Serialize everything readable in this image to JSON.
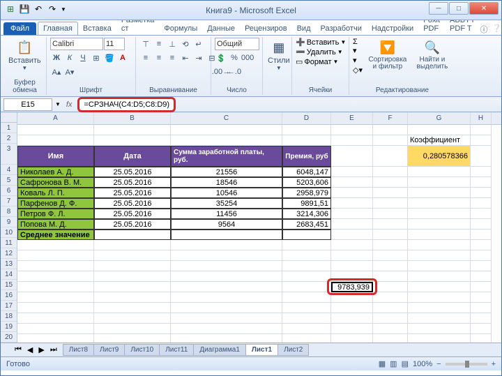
{
  "window": {
    "title": "Книга9 - Microsoft Excel"
  },
  "qat": {
    "save": "💾",
    "undo": "↶",
    "redo": "↷"
  },
  "tabs": {
    "file": "Файл",
    "home": "Главная",
    "insert": "Вставка",
    "layout": "Разметка ст",
    "formulas": "Формулы",
    "data": "Данные",
    "review": "Рецензиров",
    "view": "Вид",
    "developer": "Разработчи",
    "addins": "Надстройки",
    "foxit": "Foxit PDF",
    "abbyy": "ABBYY PDF T"
  },
  "ribbon": {
    "clipboard": {
      "paste": "Вставить",
      "label": "Буфер обмена"
    },
    "font": {
      "name": "Calibri",
      "size": "11",
      "label": "Шрифт"
    },
    "align": {
      "label": "Выравнивание"
    },
    "number": {
      "format": "Общий",
      "label": "Число"
    },
    "styles": {
      "label": "Стили"
    },
    "cells": {
      "insert": "Вставить",
      "delete": "Удалить",
      "format": "Формат",
      "label": "Ячейки"
    },
    "editing": {
      "sort": "Сортировка и фильтр",
      "find": "Найти и выделить",
      "label": "Редактирование"
    }
  },
  "namebox": "E15",
  "formula": "=СРЗНАЧ(C4:D5;C8:D9)",
  "cols": {
    "A": "A",
    "B": "B",
    "C": "C",
    "D": "D",
    "E": "E",
    "F": "F",
    "G": "G",
    "H": "H"
  },
  "headers": {
    "name": "Имя",
    "date": "Дата",
    "salary": "Сумма заработной платы, руб.",
    "bonus": "Премия, руб"
  },
  "coef_label": "Коэффициент",
  "coef_value": "0,280578366",
  "rows": [
    {
      "name": "Николаев А. Д.",
      "date": "25.05.2016",
      "salary": "21556",
      "bonus": "6048,147"
    },
    {
      "name": "Сафронова В. М.",
      "date": "25.05.2016",
      "salary": "18546",
      "bonus": "5203,606"
    },
    {
      "name": "Коваль Л. П.",
      "date": "25.05.2016",
      "salary": "10546",
      "bonus": "2958,979"
    },
    {
      "name": "Парфенов Д. Ф.",
      "date": "25.05.2016",
      "salary": "35254",
      "bonus": "9891,51"
    },
    {
      "name": "Петров Ф. Л.",
      "date": "25.05.2016",
      "salary": "11456",
      "bonus": "3214,306"
    },
    {
      "name": "Попова М. Д.",
      "date": "25.05.2016",
      "salary": "9564",
      "bonus": "2683,451"
    }
  ],
  "avg_label": "Среднее значение",
  "result": "9783,939",
  "sheets": {
    "s8": "Лист8",
    "s9": "Лист9",
    "s10": "Лист10",
    "s11": "Лист11",
    "diag": "Диаграмма1",
    "s1": "Лист1",
    "s2": "Лист2"
  },
  "status": {
    "ready": "Готово",
    "zoom": "100%"
  }
}
